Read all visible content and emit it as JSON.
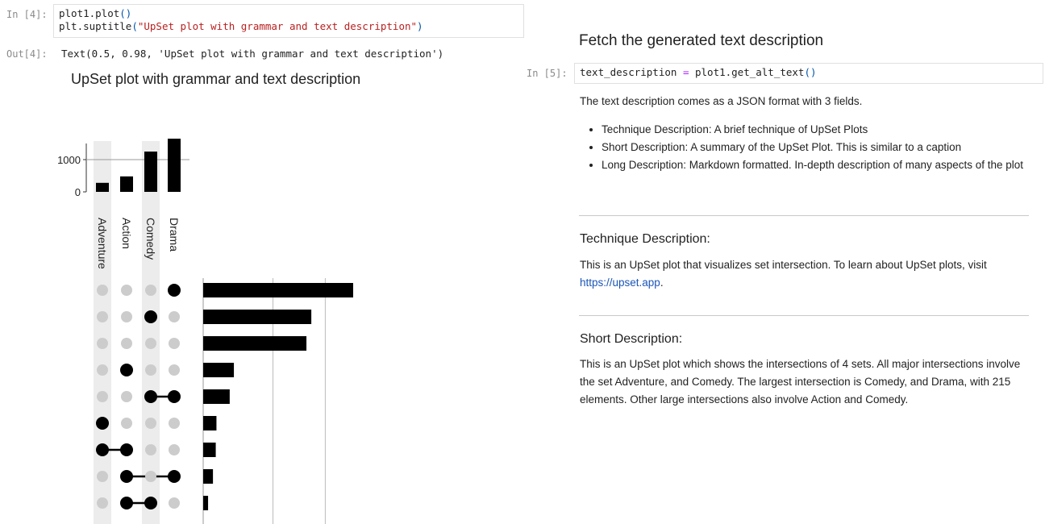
{
  "left": {
    "cell4": {
      "in_prompt": "In [4]:",
      "code": {
        "line1_a": "plot1.plot",
        "line1_paren": "()",
        "line2_a": "plt.suptitle",
        "line2_open": "(",
        "line2_str": "\"UpSet plot with grammar and text description\"",
        "line2_close": ")"
      },
      "out_prompt": "Out[4]:",
      "output_text": "Text(0.5, 0.98, 'UpSet plot with grammar and text description')"
    }
  },
  "chart_data": {
    "type": "upset",
    "title": "UpSet plot with grammar and text description",
    "sets": [
      "Adventure",
      "Action",
      "Comedy",
      "Drama"
    ],
    "set_sizes": [
      280,
      480,
      1250,
      1650
    ],
    "set_size_ticks": [
      "1000",
      "0"
    ],
    "intersections": [
      {
        "members": [
          "Drama"
        ],
        "size": 215
      },
      {
        "members": [
          "Comedy"
        ],
        "size": 155
      },
      {
        "members": [],
        "size": 148
      },
      {
        "members": [
          "Action"
        ],
        "size": 44
      },
      {
        "members": [
          "Comedy",
          "Drama"
        ],
        "size": 38
      },
      {
        "members": [
          "Adventure"
        ],
        "size": 19
      },
      {
        "members": [
          "Adventure",
          "Action"
        ],
        "size": 18
      },
      {
        "members": [
          "Action",
          "Drama"
        ],
        "size": 14
      },
      {
        "members": [
          "Action",
          "Comedy"
        ],
        "size": 7
      }
    ],
    "colors": {
      "bar": "#000000",
      "active": "#000000",
      "inactive": "#cccccc",
      "stripe": "#ececec"
    }
  },
  "right": {
    "heading_fetch": "Fetch the generated text description",
    "cell5": {
      "in_prompt": "In [5]:",
      "code": {
        "var": "text_description",
        "eq": " = ",
        "call": "plot1.get_alt_text",
        "paren": "()"
      }
    },
    "intro": "The text description comes as a JSON format with 3 fields.",
    "bullets": [
      "Technique Description: A brief technique of UpSet Plots",
      "Short Description: A summary of the UpSet Plot. This is similar to a caption",
      "Long Description: Markdown formatted. In-depth description of many aspects of the plot"
    ],
    "technique": {
      "heading": "Technique Description:",
      "text": "This is an UpSet plot that visualizes set intersection. To learn about UpSet plots, visit",
      "link": "https://upset.app",
      "after_link": "."
    },
    "short": {
      "heading": "Short Description:",
      "text": "This is an UpSet plot which shows the intersections of 4 sets. All major intersections involve the set Adventure, and Comedy. The largest intersection is Comedy, and Drama, with 215 elements. Other large intersections also involve Action and Comedy."
    }
  }
}
